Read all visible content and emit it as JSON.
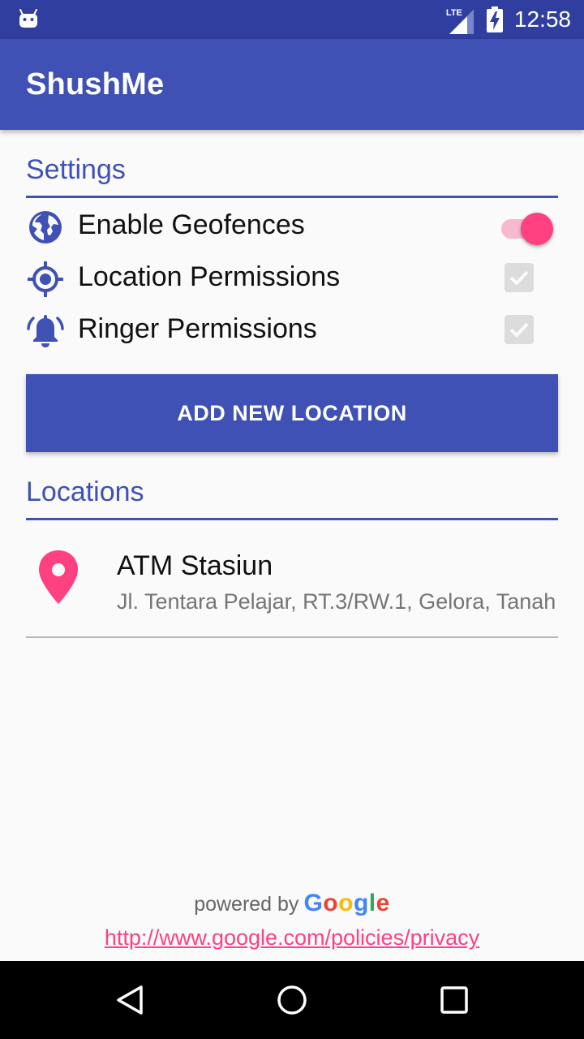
{
  "status_bar": {
    "time": "12:58",
    "network": "LTE",
    "icons": [
      "android-icon",
      "signal-icon",
      "battery-charging-icon"
    ]
  },
  "app_bar": {
    "title": "ShushMe"
  },
  "settings": {
    "title": "Settings",
    "items": [
      {
        "label": "Enable Geofences",
        "icon": "globe-icon",
        "control": "switch",
        "checked": true
      },
      {
        "label": "Location Permissions",
        "icon": "gps-target-icon",
        "control": "checkbox",
        "checked": true,
        "disabled": true
      },
      {
        "label": "Ringer Permissions",
        "icon": "bell-ringing-icon",
        "control": "checkbox",
        "checked": true,
        "disabled": true
      }
    ]
  },
  "add_button": {
    "label": "ADD NEW LOCATION"
  },
  "locations": {
    "title": "Locations",
    "items": [
      {
        "name": "ATM Stasiun",
        "address": "Jl. Tentara Pelajar, RT.3/RW.1, Gelora, Tanah",
        "icon": "location-pin-icon"
      }
    ]
  },
  "footer": {
    "powered_by": "powered by",
    "google_letters": [
      "G",
      "o",
      "o",
      "g",
      "l",
      "e"
    ],
    "policy_link": "http://www.google.com/policies/privacy"
  },
  "nav_bar": {
    "buttons": [
      "back-icon",
      "home-icon",
      "recents-icon"
    ]
  },
  "colors": {
    "primary": "#3f51b5",
    "primary_dark": "#303f9f",
    "accent": "#ff4081",
    "google": [
      "#4285f4",
      "#ea4335",
      "#fbbc05",
      "#4285f4",
      "#34a853",
      "#ea4335"
    ]
  }
}
